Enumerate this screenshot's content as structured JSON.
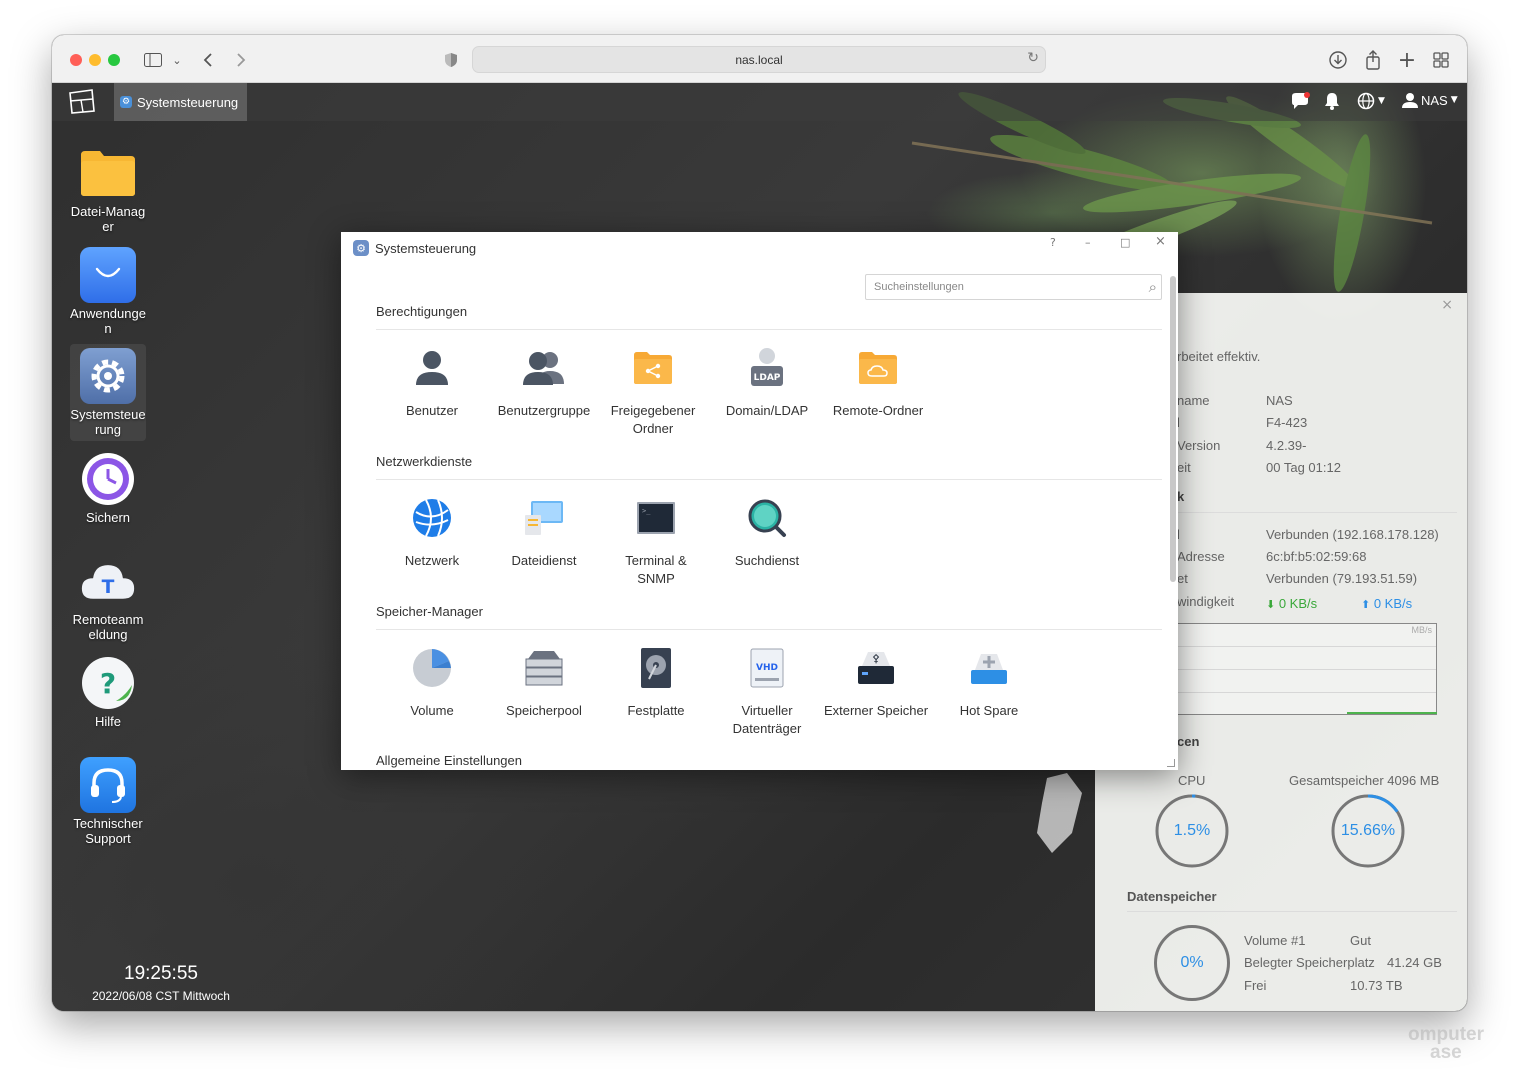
{
  "browser": {
    "url": "nas.local"
  },
  "desktop": {
    "taskbar": {
      "active_app": "Systemsteuerung",
      "user": "NAS"
    },
    "icons": [
      {
        "label": "Datei-Manager"
      },
      {
        "label": "Anwendungen"
      },
      {
        "label": "Systemsteuerung"
      },
      {
        "label": "Sichern"
      },
      {
        "label": "Remoteanmeldung"
      },
      {
        "label": "Hilfe"
      },
      {
        "label": "Technischer Support"
      }
    ],
    "clock": {
      "time": "19:25:55",
      "date": "2022/06/08 CST Mittwoch"
    }
  },
  "window": {
    "title": "Systemsteuerung",
    "controls": {
      "help": "?",
      "minimize": "–",
      "maximize": "□",
      "close": "×"
    },
    "search_placeholder": "Sucheinstellungen",
    "sections": [
      {
        "title": "Berechtigungen",
        "items": [
          {
            "label": "Benutzer",
            "icon": "user-icon"
          },
          {
            "label": "Benutzergruppe",
            "icon": "user-group-icon"
          },
          {
            "label": "Freigegebener Ordner",
            "icon": "shared-folder-icon"
          },
          {
            "label": "Domain/LDAP",
            "icon": "ldap-icon",
            "badge": "LDAP"
          },
          {
            "label": "Remote-Ordner",
            "icon": "remote-folder-icon"
          }
        ]
      },
      {
        "title": "Netzwerkdienste",
        "items": [
          {
            "label": "Netzwerk",
            "icon": "globe-icon"
          },
          {
            "label": "Dateidienst",
            "icon": "file-service-icon"
          },
          {
            "label": "Terminal & SNMP",
            "icon": "terminal-icon"
          },
          {
            "label": "Suchdienst",
            "icon": "search-service-icon"
          }
        ]
      },
      {
        "title": "Speicher-Manager",
        "items": [
          {
            "label": "Volume",
            "icon": "volume-pie-icon"
          },
          {
            "label": "Speicherpool",
            "icon": "storage-pool-icon"
          },
          {
            "label": "Festplatte",
            "icon": "hard-disk-icon"
          },
          {
            "label": "Virtueller Datenträger",
            "icon": "vhd-icon",
            "badge": "VHD"
          },
          {
            "label": "Externer Speicher",
            "icon": "usb-storage-icon"
          },
          {
            "label": "Hot Spare",
            "icon": "hot-spare-icon"
          }
        ]
      },
      {
        "title": "Allgemeine Einstellungen",
        "items": []
      }
    ]
  },
  "widget": {
    "status_text": "rbeitet effektiv.",
    "info": [
      {
        "key": "name",
        "value": "NAS"
      },
      {
        "key": "l",
        "value": "F4-423"
      },
      {
        "key": "Version",
        "value": "4.2.39-"
      },
      {
        "key": "eit",
        "value": "00 Tag 01:12"
      }
    ],
    "network_heading": "k",
    "network": [
      {
        "key": "l",
        "value": "Verbunden (192.168.178.128)"
      },
      {
        "key": "Adresse",
        "value": "6c:bf:b5:02:59:68"
      },
      {
        "key": "et",
        "value": "Verbunden (79.193.51.59)"
      }
    ],
    "speed": {
      "key": "windigkeit",
      "down": "0 KB/s",
      "up": "0 KB/s"
    },
    "graph_unit": "MB/s",
    "resources_heading": "cen",
    "cpu": {
      "label": "CPU",
      "value": "1.5%",
      "fraction": 0.015
    },
    "memory": {
      "label": "Gesamtspeicher 4096 MB",
      "value": "15.66%",
      "fraction": 0.1566
    },
    "storage_heading": "Datenspeicher",
    "storage": {
      "ring": "0%",
      "rows": [
        {
          "key": "Volume #1",
          "value": "Gut"
        },
        {
          "key": "Belegter Speicherplatz",
          "value": "41.24 GB"
        },
        {
          "key": "Frei",
          "value": "10.73 TB"
        }
      ]
    }
  },
  "watermark": {
    "line1": "omputer",
    "line2": "ase"
  }
}
